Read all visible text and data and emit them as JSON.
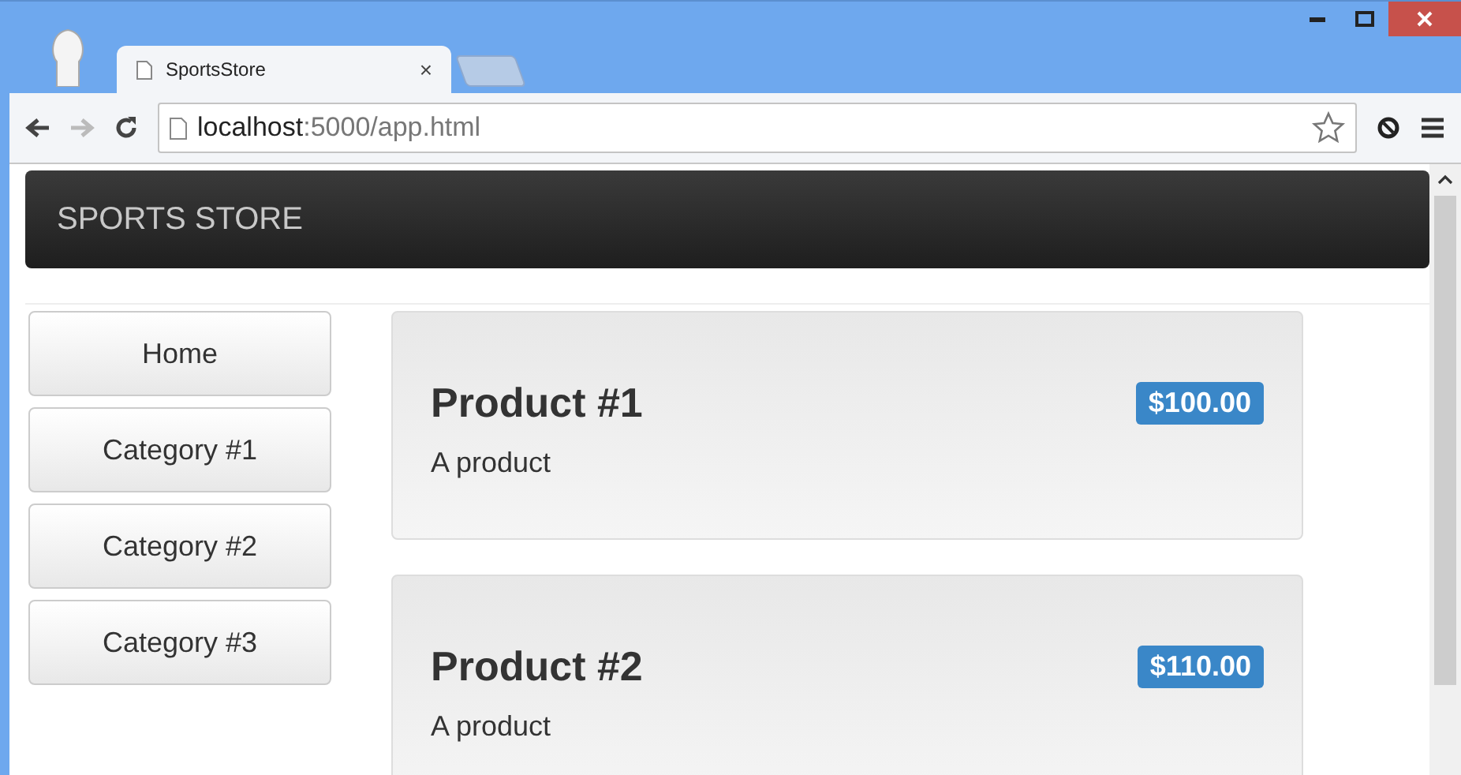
{
  "browser": {
    "tab_title": "SportsStore",
    "tab_close": "×",
    "address_host": "localhost",
    "address_rest": ":5000/app.html"
  },
  "navbar": {
    "brand": "SPORTS STORE"
  },
  "sidebar": {
    "items": [
      {
        "label": "Home"
      },
      {
        "label": "Category #1"
      },
      {
        "label": "Category #2"
      },
      {
        "label": "Category #3"
      }
    ]
  },
  "products": [
    {
      "name": "Product #1",
      "price": "$100.00",
      "description": "A product"
    },
    {
      "name": "Product #2",
      "price": "$110.00",
      "description": "A product"
    }
  ]
}
